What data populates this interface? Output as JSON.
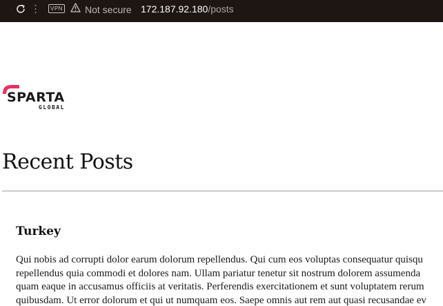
{
  "browser": {
    "vpn_label": "VPN",
    "security_label": "Not secure",
    "url_host": "172.187.92.180",
    "url_path": "/posts"
  },
  "logo": {
    "word_main": "SPARTA",
    "word_sub": "GLOBAL",
    "accent_color": "#e8305a"
  },
  "main": {
    "heading": "Recent Posts",
    "posts": [
      {
        "title": "Turkey",
        "body_lines": [
          "Qui nobis ad corrupti dolor earum dolorum repellendus. Qui cum eos voluptas consequatur quisqu",
          "repellendus quia commodi et dolores nam. Ullam pariatur tenetur sit nostrum dolorem assumenda",
          "quam eaque in accusamus officiis at veritatis. Perferendis exercitationem et sunt voluptatem rerum",
          "quibusdam. Ut error dolorum et qui ut numquam eos. Saepe omnis aut rem aut quasi recusandae ev"
        ]
      }
    ]
  }
}
